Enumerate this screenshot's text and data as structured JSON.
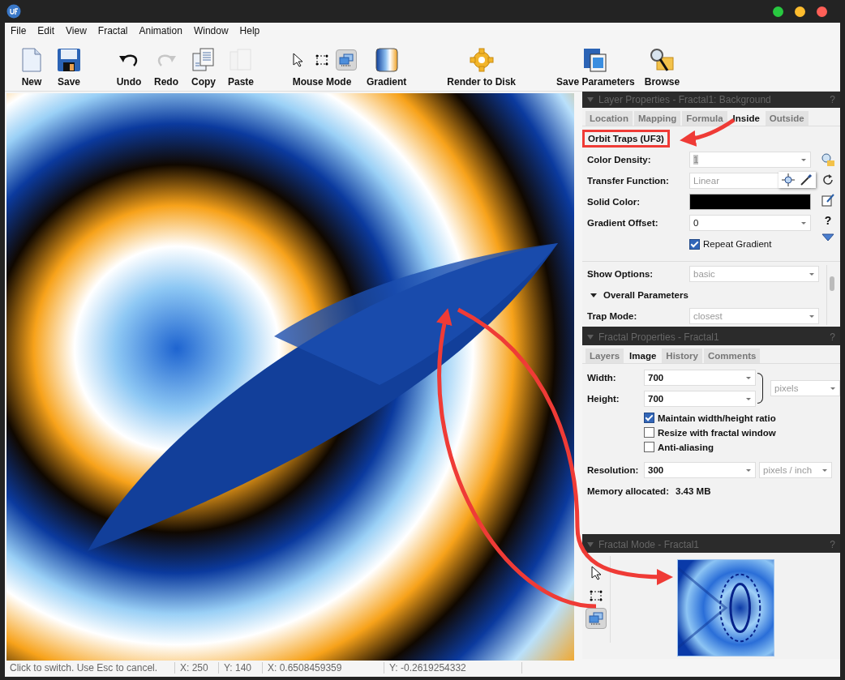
{
  "menu": [
    "File",
    "Edit",
    "View",
    "Fractal",
    "Animation",
    "Window",
    "Help"
  ],
  "toolbar": {
    "new": {
      "label": "New",
      "disabled": false
    },
    "save": {
      "label": "Save",
      "disabled": false
    },
    "undo": {
      "label": "Undo",
      "disabled": false
    },
    "redo": {
      "label": "Redo",
      "disabled": true
    },
    "copy": {
      "label": "Copy",
      "disabled": false
    },
    "paste": {
      "label": "Paste",
      "disabled": true
    },
    "mouse_mode": {
      "label": "Mouse Mode",
      "tools": [
        {
          "selected": false
        },
        {
          "selected": false
        },
        {
          "selected": true
        }
      ]
    },
    "gradient": {
      "label": "Gradient"
    },
    "render": {
      "label": "Render to Disk"
    },
    "save_parameters": {
      "label": "Save Parameters"
    },
    "browse": {
      "label": "Browse"
    }
  },
  "layer_properties": {
    "title": "Layer Properties - Fractal1: Background",
    "help": "?",
    "tabs": [
      {
        "label": "Location",
        "selected": false
      },
      {
        "label": "Mapping",
        "selected": false
      },
      {
        "label": "Formula",
        "selected": false
      },
      {
        "label": "Inside",
        "selected": true
      },
      {
        "label": "Outside",
        "selected": false
      }
    ],
    "formula_name": {
      "text": "Orbit Traps (UF3)",
      "highlighted": true
    },
    "fields": [
      {
        "kind": "combo",
        "label": "Color Density:",
        "value": "1",
        "disabled": true
      },
      {
        "kind": "text",
        "label": "Transfer Function:",
        "value": "Linear",
        "disabled": true
      },
      {
        "kind": "color",
        "label": "Solid Color:",
        "color": "#000000"
      },
      {
        "kind": "combo",
        "label": "Gradient Offset:",
        "value": "0",
        "disabled": false
      }
    ],
    "side_help": "?",
    "repeat_gradient": {
      "label": "Repeat Gradient",
      "checked": true
    },
    "show_options": {
      "label": "Show Options:",
      "value": "basic"
    },
    "section": {
      "label": "Overall Parameters",
      "expanded": true
    },
    "trap_mode": {
      "label": "Trap Mode:",
      "value": "closest"
    }
  },
  "fractal_properties": {
    "title": "Fractal Properties - Fractal1",
    "help": "?",
    "tabs": [
      {
        "label": "Layers",
        "selected": false
      },
      {
        "label": "Image",
        "selected": true
      },
      {
        "label": "History",
        "selected": false
      },
      {
        "label": "Comments",
        "selected": false
      }
    ],
    "width": {
      "label": "Width:",
      "value": "700"
    },
    "height": {
      "label": "Height:",
      "value": "700"
    },
    "size_unit": "pixels",
    "options": [
      {
        "label": "Maintain width/height ratio",
        "checked": true
      },
      {
        "label": "Resize with fractal window",
        "checked": false
      },
      {
        "label": "Anti-aliasing",
        "checked": false
      }
    ],
    "resolution": {
      "label": "Resolution:",
      "value": "300",
      "unit": "pixels / inch"
    },
    "memory": {
      "label": "Memory allocated:",
      "value": "3.43 MB"
    }
  },
  "fractal_mode": {
    "title": "Fractal Mode - Fractal1",
    "help": "?",
    "tools": [
      {
        "selected": false
      },
      {
        "selected": false
      },
      {
        "selected": true
      }
    ]
  },
  "status_bar": [
    "Click to switch. Use Esc to cancel.",
    "X: 250",
    "Y: 140",
    "X: 0.6508459359",
    "Y: -0.2619254332"
  ]
}
